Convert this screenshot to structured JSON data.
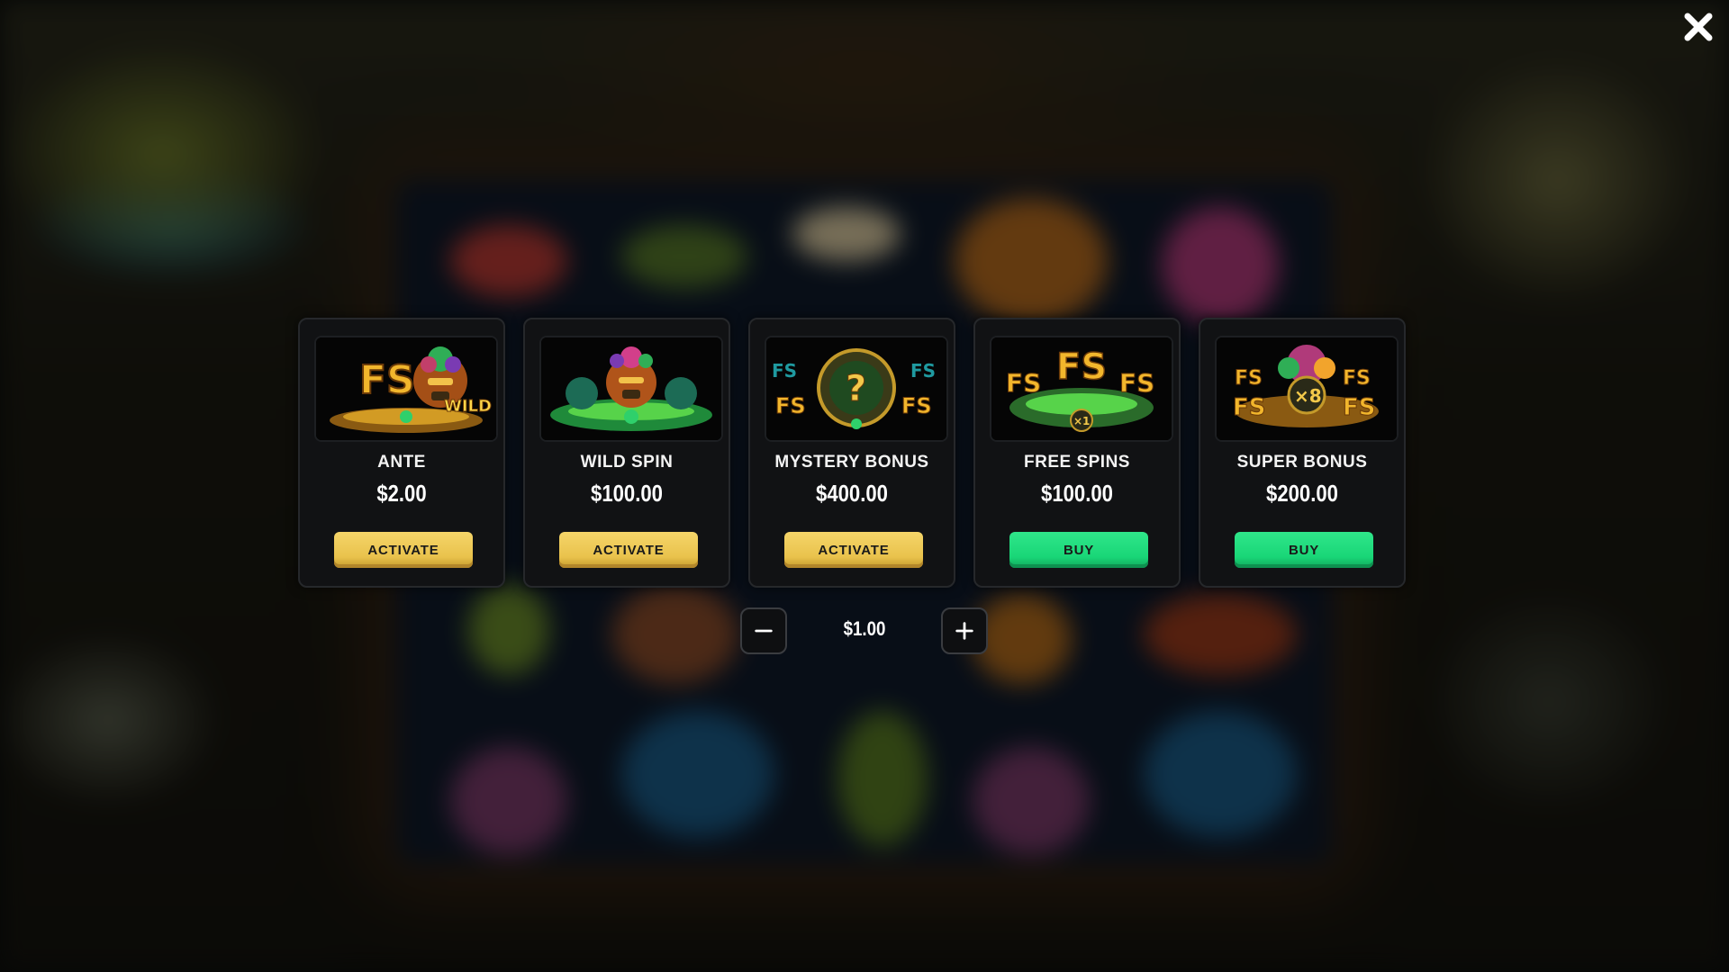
{
  "close_icon": "close-icon",
  "cards": [
    {
      "title": "ANTE",
      "price": "$2.00",
      "button_label": "ACTIVATE",
      "button_style": "activate",
      "image_text": [
        "FS",
        "WILD"
      ]
    },
    {
      "title": "WILD SPIN",
      "price": "$100.00",
      "button_label": "ACTIVATE",
      "button_style": "activate",
      "image_text": []
    },
    {
      "title": "MYSTERY BONUS",
      "price": "$400.00",
      "button_label": "ACTIVATE",
      "button_style": "activate",
      "image_text": [
        "FS",
        "FS",
        "FS",
        "FS",
        "?"
      ]
    },
    {
      "title": "FREE SPINS",
      "price": "$100.00",
      "button_label": "BUY",
      "button_style": "buy",
      "image_text": [
        "FS",
        "FS",
        "FS",
        "×1"
      ]
    },
    {
      "title": "SUPER BONUS",
      "price": "$200.00",
      "button_label": "BUY",
      "button_style": "buy",
      "image_text": [
        "FS",
        "FS",
        "FS",
        "FS",
        "×8"
      ]
    }
  ],
  "bet": {
    "value": "$1.00",
    "decrease_icon": "minus-icon",
    "increase_icon": "plus-icon"
  },
  "colors": {
    "activate_button": "#e9c24c",
    "buy_button": "#19d677",
    "card_background": "#111214"
  }
}
